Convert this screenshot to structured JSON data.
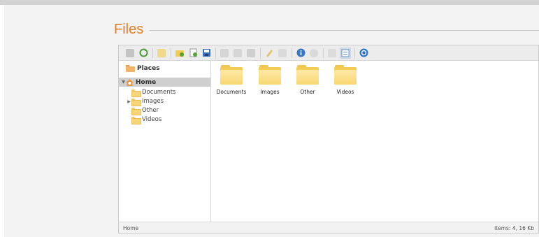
{
  "page": {
    "title": "Files"
  },
  "toolbar": {
    "colors": {
      "green": "#4f9a3c",
      "blue": "#3b77c9",
      "gray": "#b9b9b9",
      "yellow": "#e8c65a",
      "help": "#2f73c4"
    },
    "buttons": [
      {
        "icon": "back-icon",
        "color": "#b9b9b9"
      },
      {
        "icon": "reload-icon",
        "color": "#4f9a3c"
      },
      {
        "icon": "open-icon",
        "color": "#e8c65a"
      },
      {
        "icon": "new-folder-icon",
        "color": "#5aa03f"
      },
      {
        "icon": "new-file-icon",
        "color": "#5aa03f"
      },
      {
        "icon": "save-icon",
        "color": "#3b6fb8"
      },
      {
        "icon": "copy-icon",
        "color": "#b9b9b9"
      },
      {
        "icon": "paste-icon",
        "color": "#b9b9b9"
      },
      {
        "icon": "delete-icon",
        "color": "#b9b9b9"
      },
      {
        "icon": "rename-icon",
        "color": "#d7b45a"
      },
      {
        "icon": "edit-icon",
        "color": "#b9b9b9"
      },
      {
        "icon": "info-icon",
        "color": "#3b77c9"
      },
      {
        "icon": "preview-icon",
        "color": "#b9b9b9"
      },
      {
        "icon": "icons-view-icon",
        "color": "#b9b9b9"
      },
      {
        "icon": "list-view-icon",
        "color": "#6d8fc0"
      },
      {
        "icon": "help-icon",
        "color": "#2f73c4"
      }
    ]
  },
  "sidebar": {
    "places_label": "Places",
    "home_label": "Home",
    "items": [
      {
        "label": "Documents",
        "expandable": false
      },
      {
        "label": "Images",
        "expandable": true
      },
      {
        "label": "Other",
        "expandable": false
      },
      {
        "label": "Videos",
        "expandable": false
      }
    ]
  },
  "content": {
    "items": [
      {
        "label": "Documents"
      },
      {
        "label": "Images"
      },
      {
        "label": "Other"
      },
      {
        "label": "Videos"
      }
    ]
  },
  "status": {
    "path": "Home",
    "summary": "items: 4, 16 Kb"
  }
}
